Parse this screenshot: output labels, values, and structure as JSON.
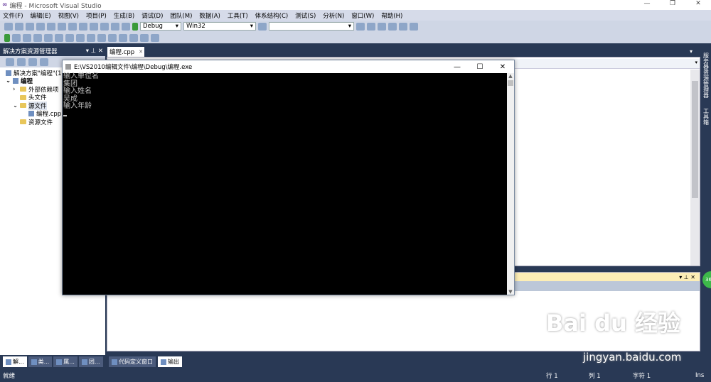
{
  "window": {
    "title": "编程 - Microsoft Visual Studio",
    "min": "—",
    "max": "❐",
    "close": "✕"
  },
  "menu": [
    "文件(F)",
    "编辑(E)",
    "视图(V)",
    "项目(P)",
    "生成(B)",
    "调试(D)",
    "团队(M)",
    "数据(A)",
    "工具(T)",
    "体系结构(C)",
    "测试(S)",
    "分析(N)",
    "窗口(W)",
    "帮助(H)"
  ],
  "toolbar": {
    "config": "Debug",
    "platform": "Win32",
    "find": ""
  },
  "solution_explorer": {
    "title": "解决方案资源管理器",
    "pin": "▾ ⊥ ✕",
    "items": [
      {
        "label": "解决方案\"编程\"(1 个项目)",
        "level": 0
      },
      {
        "label": "编程",
        "level": 1,
        "bold": true
      },
      {
        "label": "外部依赖项",
        "level": 2
      },
      {
        "label": "头文件",
        "level": 2
      },
      {
        "label": "源文件",
        "level": 2
      },
      {
        "label": "编程.cpp",
        "level": 3
      },
      {
        "label": "资源文件",
        "level": 2
      }
    ]
  },
  "doc_tab": {
    "label": "编程.cpp",
    "close": "✕"
  },
  "right_side": [
    "服务器资源管理器",
    "工具箱"
  ],
  "output": {
    "controls": "▾ ⊥ ✕"
  },
  "console": {
    "title": "E:\\VS2010编辑文件\\编程\\Debug\\编程.exe",
    "lines": [
      "输入单位名",
      "集团",
      "输入姓名",
      "吴成",
      "输入年龄"
    ],
    "min": "—",
    "max": "☐",
    "close": "✕"
  },
  "bottom_tabs": [
    "解...",
    "类...",
    "属...",
    "团...",
    "代码定义窗口",
    "输出"
  ],
  "status": {
    "ready": "就绪",
    "line": "行 1",
    "col": "列 1",
    "char": "字符 1",
    "mode": "Ins"
  },
  "watermark": {
    "brand": "Bai du 经验",
    "url": "jingyan.baidu.com"
  },
  "badge": "36"
}
